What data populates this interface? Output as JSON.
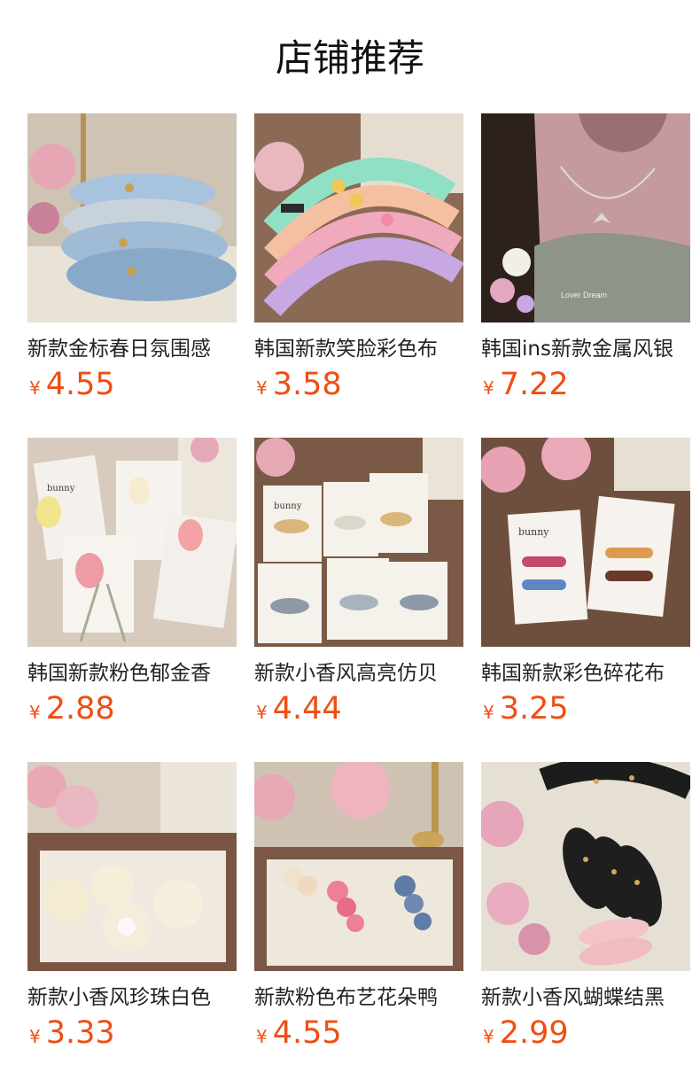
{
  "section": {
    "title": "店铺推荐"
  },
  "products": [
    {
      "name": "新款金标春日氛围感",
      "currency": "¥",
      "price": "4.55",
      "image": "blue-headbands-photo"
    },
    {
      "name": "韩国新款笑脸彩色布",
      "currency": "¥",
      "price": "3.58",
      "image": "pastel-smiley-headbands-photo"
    },
    {
      "name": "韩国ins新款金属风银",
      "currency": "¥",
      "price": "7.22",
      "image": "bow-necklace-photo",
      "watermark": "Lover Dream"
    },
    {
      "name": "韩国新款粉色郁金香",
      "currency": "¥",
      "price": "2.88",
      "image": "tulip-hairclips-photo",
      "card_brand": "bunny"
    },
    {
      "name": "新款小香风高亮仿贝",
      "currency": "¥",
      "price": "4.44",
      "image": "pearl-hairclips-photo",
      "card_brand": "bunny"
    },
    {
      "name": "韩国新款彩色碎花布",
      "currency": "¥",
      "price": "3.25",
      "image": "floral-hairclips-photo",
      "card_brand": "bunny"
    },
    {
      "name": "新款小香风珍珠白色",
      "currency": "¥",
      "price": "3.33",
      "image": "white-rose-clips-photo"
    },
    {
      "name": "新款粉色布艺花朵鸭",
      "currency": "¥",
      "price": "4.55",
      "image": "fabric-flower-clips-photo"
    },
    {
      "name": "新款小香风蝴蝶结黑",
      "currency": "¥",
      "price": "2.99",
      "image": "black-bow-headband-photo"
    }
  ]
}
